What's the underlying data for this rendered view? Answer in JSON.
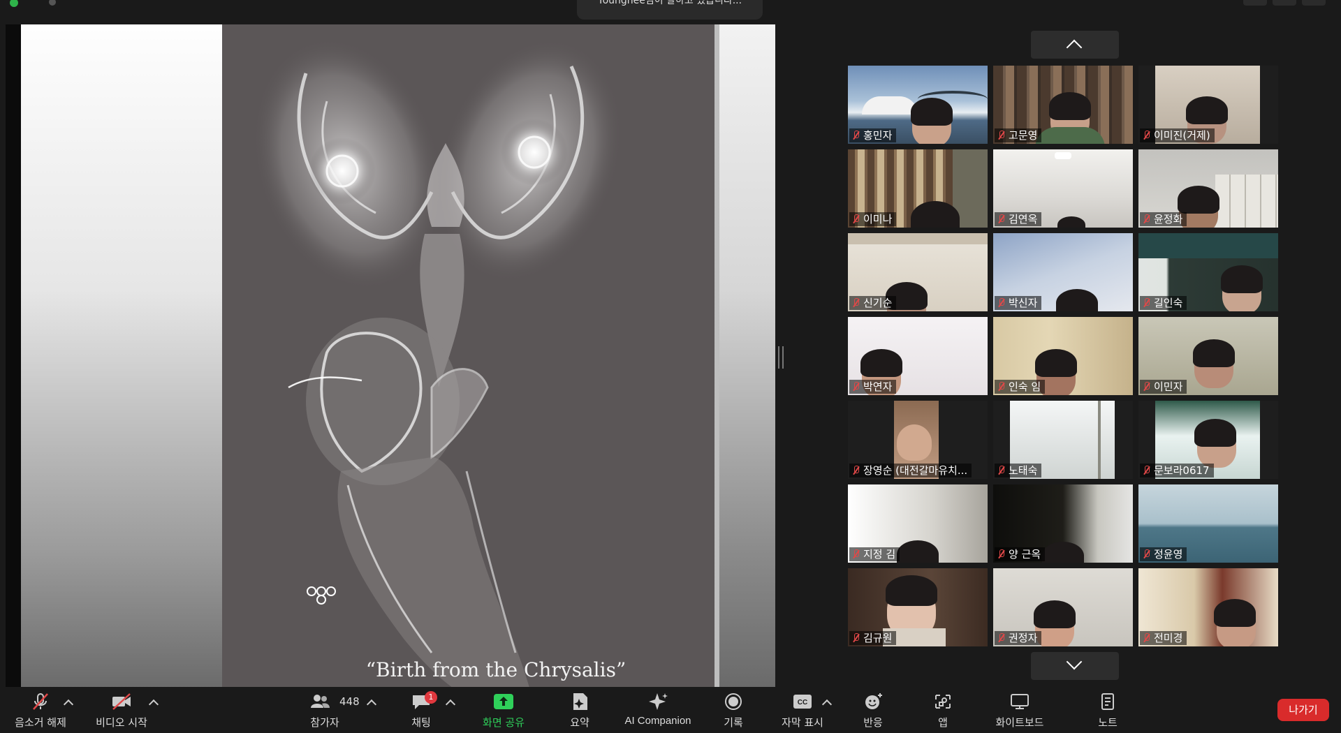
{
  "top": {
    "toast": "Younghee님이 말하고 있습니다..."
  },
  "slide": {
    "caption": "“Birth from the Chrysalis”"
  },
  "participants": [
    {
      "name": "홍민자",
      "muted": true
    },
    {
      "name": "고문영",
      "muted": true
    },
    {
      "name": "이미진(거제)",
      "muted": true
    },
    {
      "name": "이미나",
      "muted": true
    },
    {
      "name": "김연옥",
      "muted": true
    },
    {
      "name": "윤정화",
      "muted": true
    },
    {
      "name": "신기순",
      "muted": true
    },
    {
      "name": "박신자",
      "muted": true
    },
    {
      "name": "길인숙",
      "muted": true
    },
    {
      "name": "박연자",
      "muted": true
    },
    {
      "name": "인숙 임",
      "muted": true
    },
    {
      "name": "이민자",
      "muted": true
    },
    {
      "name": "장영순 (대전갈마유치...",
      "muted": true
    },
    {
      "name": "노태숙",
      "muted": true
    },
    {
      "name": "문보라0617",
      "muted": true
    },
    {
      "name": "지정 김",
      "muted": true
    },
    {
      "name": "양 근옥",
      "muted": true
    },
    {
      "name": "정윤영",
      "muted": true
    },
    {
      "name": "김규원",
      "muted": true
    },
    {
      "name": "권정자",
      "muted": true
    },
    {
      "name": "전미경",
      "muted": true
    }
  ],
  "toolbar": {
    "unmute": "음소거 해제",
    "start_video": "비디오 시작",
    "participants": "참가자",
    "participant_count": "448",
    "chat": "채팅",
    "chat_badge": "1",
    "share_screen": "화면 공유",
    "summary": "요약",
    "ai_companion": "AI Companion",
    "record": "기록",
    "captions": "자막 표시",
    "reactions": "반응",
    "apps": "앱",
    "whiteboard": "화이트보드",
    "notes": "노트",
    "leave": "나가기"
  },
  "colors": {
    "accent_green": "#2fd05a",
    "leave_red": "#d92b2b",
    "muted_red": "#e14848"
  }
}
